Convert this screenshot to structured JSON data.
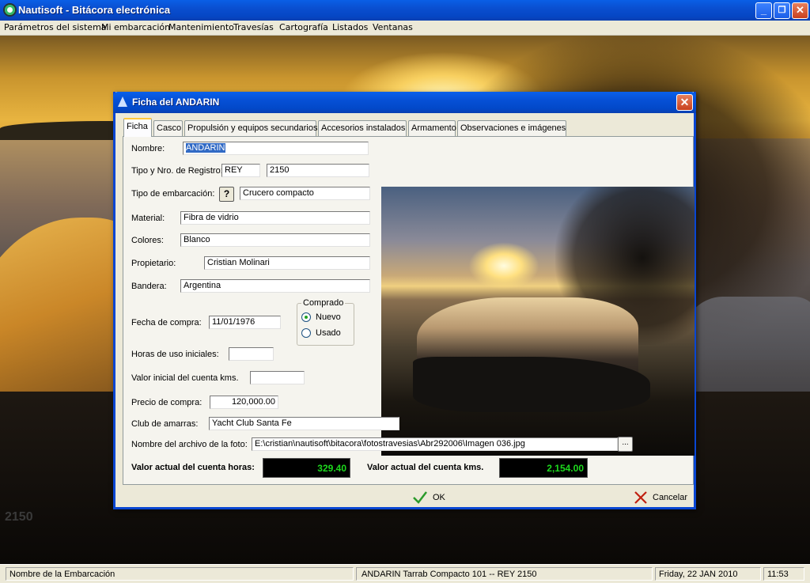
{
  "app": {
    "title": "Nautisoft - Bitácora electrónica",
    "window_buttons": {
      "minimize": "_",
      "maximize": "❐",
      "close": "✕"
    }
  },
  "menubar": {
    "items": [
      "Parámetros del sistema",
      "Mi embarcación",
      "Mantenimiento",
      "Travesías",
      "Cartografía",
      "Listados",
      "Ventanas"
    ]
  },
  "background": {
    "registration": "2150"
  },
  "dialog": {
    "title": "Ficha del ANDARIN",
    "close": "✕",
    "tabs": [
      "Ficha",
      "Casco",
      "Propulsión y equipos secundarios",
      "Accesorios instalados",
      "Armamento",
      "Observaciones e imágenes"
    ],
    "active_tab": "Ficha",
    "form": {
      "nombre_label": "Nombre:",
      "nombre": "ANDARIN",
      "tipo_registro_label": "Tipo y Nro. de Registro:",
      "tipo_registro": "REY",
      "nro_registro": "2150",
      "tipo_embarcacion_label": "Tipo de embarcación:",
      "tipo_embarcacion_help": "?",
      "tipo_embarcacion": "Crucero compacto",
      "material_label": "Material:",
      "material": "Fibra de vidrio",
      "colores_label": "Colores:",
      "colores": "Blanco",
      "propietario_label": "Propietario:",
      "propietario": "Cristian Molinari",
      "bandera_label": "Bandera:",
      "bandera": "Argentina",
      "fecha_compra_label": "Fecha de compra:",
      "fecha_compra": "11/01/1976",
      "comprado_label": "Comprado",
      "comprado_nuevo": "Nuevo",
      "comprado_usado": "Usado",
      "comprado_value": "Nuevo",
      "horas_uso_label": "Horas de uso iniciales:",
      "horas_uso": "",
      "valor_kms_label": "Valor inicial del cuenta kms.",
      "valor_kms": "",
      "precio_label": "Precio de compra:",
      "precio": "120,000.00",
      "club_label": "Club de amarras:",
      "club": "Yacht Club Santa Fe",
      "foto_label": "Nombre del archivo de la foto:",
      "foto": "E:\\cristian\\nautisoft\\bitacora\\fotostravesias\\Abr292006\\Imagen 036.jpg",
      "foto_browse": "...",
      "horas_actual_label": "Valor actual del cuenta horas:",
      "horas_actual": "329.40",
      "kms_actual_label": "Valor actual del cuenta kms.",
      "kms_actual": "2,154.00"
    },
    "ok_label": "OK",
    "cancel_label": "Cancelar"
  },
  "statusbar": {
    "field": "Nombre de la Embarcación",
    "boat": "ANDARIN     Tarrab Compacto 101 -- REY 2150",
    "date": "Friday, 22 JAN 2010",
    "time": "11:53"
  },
  "colors": {
    "titlebar": "#0a4fd0",
    "lcd_text": "#1dd81d",
    "tab_highlight": "#ffc83c"
  }
}
